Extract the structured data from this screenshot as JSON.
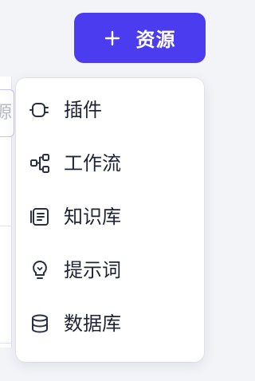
{
  "header": {
    "resource_button": {
      "icon": "plus-icon",
      "label": "资源"
    }
  },
  "background": {
    "search_text": "资源"
  },
  "menu": {
    "items": [
      {
        "label": "插件",
        "icon": "plugin-icon"
      },
      {
        "label": "工作流",
        "icon": "workflow-icon"
      },
      {
        "label": "知识库",
        "icon": "knowledge-base-icon"
      },
      {
        "label": "提示词",
        "icon": "lightbulb-icon"
      },
      {
        "label": "数据库",
        "icon": "database-icon"
      }
    ]
  },
  "colors": {
    "accent": "#4b3cf0",
    "text": "#1f2333",
    "menu_background": "#ffffff",
    "page_background": "#f3f4f8"
  }
}
